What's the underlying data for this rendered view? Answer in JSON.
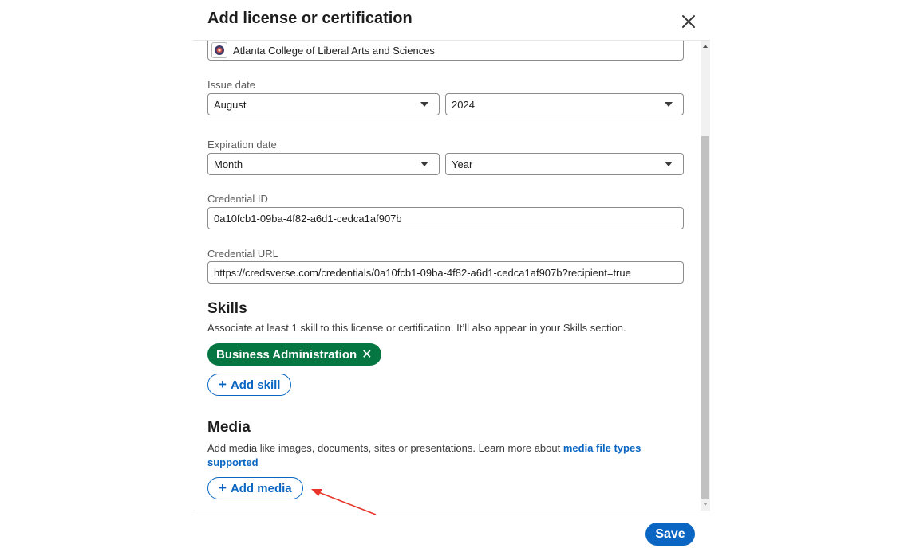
{
  "modal": {
    "title": "Add license or certification",
    "close_icon": "close-icon"
  },
  "organization": {
    "value": "Atlanta College of Liberal Arts and Sciences",
    "logo_icon": "organization-logo-icon"
  },
  "issue_date": {
    "label": "Issue date",
    "month": "August",
    "year": "2024"
  },
  "expiration_date": {
    "label": "Expiration date",
    "month": "Month",
    "year": "Year"
  },
  "credential_id": {
    "label": "Credential ID",
    "value": "0a10fcb1-09ba-4f82-a6d1-cedca1af907b"
  },
  "credential_url": {
    "label": "Credential URL",
    "value": "https://credsverse.com/credentials/0a10fcb1-09ba-4f82-a6d1-cedca1af907b?recipient=true"
  },
  "skills": {
    "title": "Skills",
    "description": "Associate at least 1 skill to this license or certification. It’ll also appear in your Skills section.",
    "chips": [
      {
        "label": "Business Administration",
        "remove_icon": "close-icon"
      }
    ],
    "add_label": "Add skill"
  },
  "media": {
    "title": "Media",
    "description": "Add media like images, documents, sites or presentations. Learn more about ",
    "link_text_1": "media file types",
    "link_text_2": "supported",
    "add_label": "Add media"
  },
  "footer": {
    "save_label": "Save"
  },
  "colors": {
    "primary": "#0a66c2",
    "chip_green": "#057642",
    "annotation_red": "#e8342a"
  }
}
